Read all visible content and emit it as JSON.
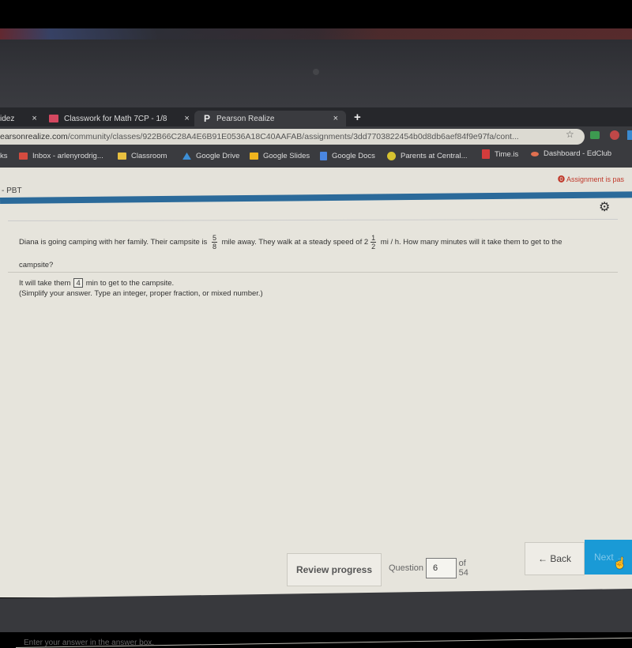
{
  "browser": {
    "tabs": [
      {
        "label": "idez",
        "active": false
      },
      {
        "label": "Classwork for Math 7CP - 1/8",
        "active": false,
        "icon": "google-classroom-icon"
      },
      {
        "label": "Pearson Realize",
        "active": true,
        "icon": "pearson-p-icon"
      }
    ],
    "close_glyph": "×",
    "new_tab_glyph": "+",
    "url_host": "earsonrealize.com",
    "url_path": "/community/classes/922B66C28A4E6B91E0536A18C40AAFAB/assignments/3dd7703822454b0d8db6aef84f9e97fa/cont...",
    "star_glyph": "☆",
    "bookmarks": [
      {
        "label": "ks",
        "icon": "none"
      },
      {
        "label": "Inbox - arlenyrodrig...",
        "icon": "gmail-icon",
        "color": "#d44b3f"
      },
      {
        "label": "Classroom",
        "icon": "google-classroom-icon",
        "color": "#3d9a50"
      },
      {
        "label": "Google Drive",
        "icon": "google-drive-icon",
        "color": "#3d8fd6"
      },
      {
        "label": "Google Slides",
        "icon": "google-slides-icon",
        "color": "#f0b41e"
      },
      {
        "label": "Google Docs",
        "icon": "google-docs-icon",
        "color": "#4a86e0"
      },
      {
        "label": "Parents at Central...",
        "icon": "central-logo-icon",
        "color": "#d6c230"
      },
      {
        "label": "Time.is",
        "icon": "time-is-icon",
        "color": "#d43c3c"
      },
      {
        "label": "Dashboard - EdClub",
        "icon": "edclub-icon",
        "color": "#e07050"
      }
    ]
  },
  "page": {
    "breadcrumb": "- PBT",
    "alert": "Assignment is pas",
    "alert_color": "#c0392b",
    "accent_color": "#2b6a9a",
    "gear_glyph": "⚙"
  },
  "question": {
    "text_part1": "Diana is going camping with her family. Their campsite is",
    "frac1": {
      "num": "5",
      "den": "8"
    },
    "text_part2": "mile away. They walk at a steady speed of 2",
    "frac2": {
      "num": "1",
      "den": "2"
    },
    "text_part3": "mi / h. How many minutes will it take them to get to the",
    "text_line2": "campsite?",
    "answer_prefix": "It will take them",
    "answer_value": "4",
    "answer_suffix": "min to get to the campsite.",
    "hint": "(Simplify your answer. Type an integer, proper fraction, or mixed number.)"
  },
  "footer": {
    "instruction": "Enter your answer in the answer box.",
    "review_label": "Review progress",
    "question_label": "Question",
    "question_number": "6",
    "of_total": "of 54",
    "back_label": "← Back",
    "next_label": "Next →",
    "next_color": "#1a9ad6"
  }
}
